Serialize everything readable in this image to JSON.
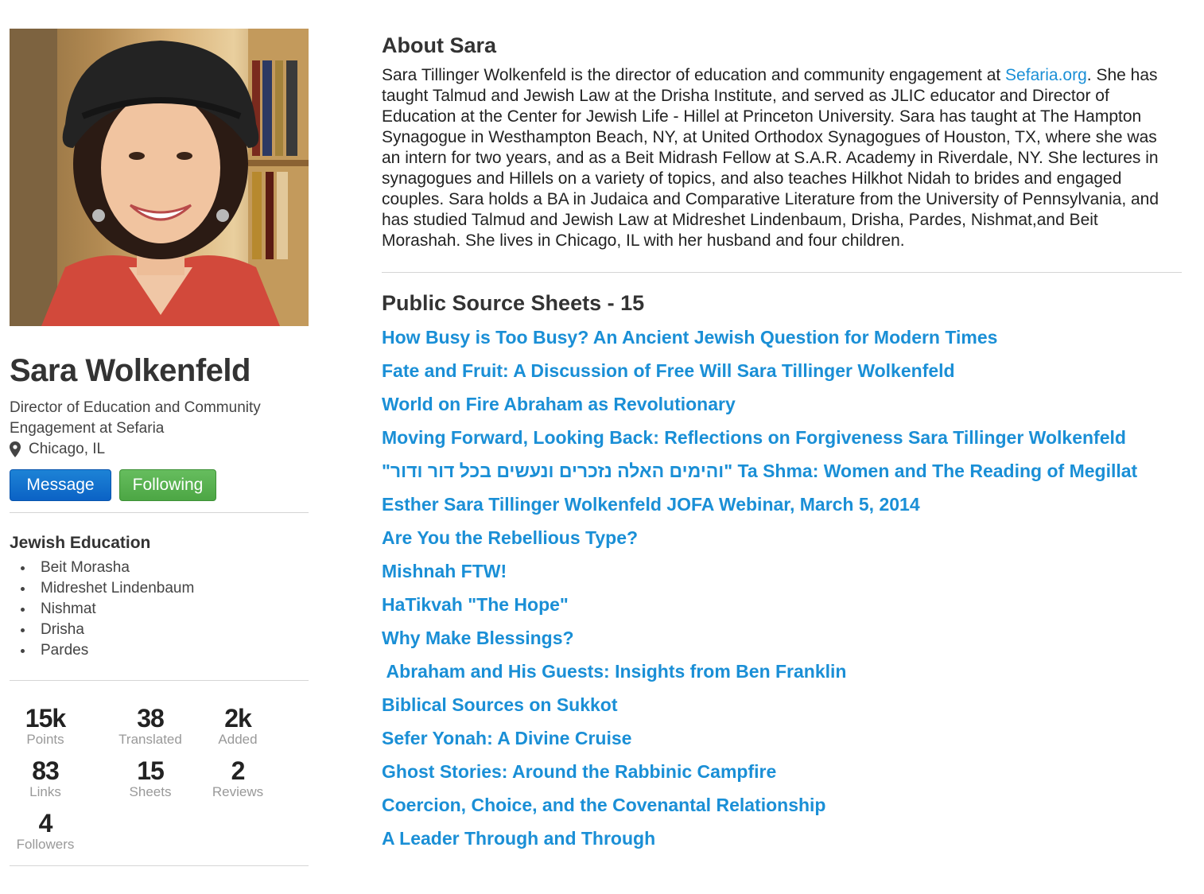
{
  "profile": {
    "name": "Sara Wolkenfeld",
    "title": "Director of Education and Community Engagement at Sefaria",
    "location": "Chicago, IL",
    "photo_alt": "Profile photo"
  },
  "buttons": {
    "message_label": "Message",
    "following_label": "Following"
  },
  "education": {
    "heading": "Jewish Education",
    "items": [
      "Beit Morasha",
      "Midreshet Lindenbaum",
      "Nishmat",
      "Drisha",
      "Pardes"
    ]
  },
  "stats": [
    {
      "value": "15k",
      "label": "Points"
    },
    {
      "value": "38",
      "label": "Translated"
    },
    {
      "value": "2k",
      "label": "Added"
    },
    {
      "value": "83",
      "label": "Links"
    },
    {
      "value": "15",
      "label": "Sheets"
    },
    {
      "value": "2",
      "label": "Reviews"
    },
    {
      "value": "4",
      "label": "Followers"
    }
  ],
  "about": {
    "heading": "About Sara",
    "bio_before_link": "Sara Tillinger Wolkenfeld is the director of education and community engagement at ",
    "bio_link": "Sefaria.org",
    "bio_after_link": ". She has taught Talmud and Jewish Law at the Drisha Institute, and served as JLIC educator and Director of Education at the Center for Jewish Life - Hillel at Princeton University. Sara has taught at The Hampton Synagogue in Westhampton Beach, NY, at United Orthodox Synagogues of Houston, TX, where she was an intern for two years, and as a Beit Midrash Fellow at S.A.R. Academy in Riverdale, NY. She lectures in synagogues and Hillels on a variety of topics, and also teaches Hilkhot Nidah to brides and engaged couples. Sara holds a BA in Judaica and Comparative Literature from the University of Pennsylvania, and has studied Talmud and Jewish Law at Midreshet Lindenbaum, Drisha, Pardes, Nishmat,and Beit Morashah. She lives in Chicago, IL with her husband and four children."
  },
  "sheets": {
    "heading": "Public Source Sheets - 15",
    "items": [
      "How Busy is Too Busy? An Ancient Jewish Question for Modern Times",
      "Fate and Fruit: A Discussion of Free Will Sara Tillinger Wolkenfeld",
      "World on Fire Abraham as Revolutionary",
      "Moving Forward, Looking Back: Reflections on Forgiveness Sara Tillinger Wolkenfeld",
      "\"והימים האלה נזכרים ונעשים בכל דור ודור\" Ta Shma: Women and The Reading of Megillat",
      "Esther Sara Tillinger Wolkenfeld JOFA Webinar, March 5, 2014",
      "Are You the Rebellious Type?",
      "Mishnah FTW!",
      "HaTikvah \"The Hope\"",
      "Why Make Blessings?",
      " Abraham and His Guests: Insights from Ben Franklin",
      "Biblical Sources on Sukkot",
      "Sefer Yonah: A Divine Cruise",
      "Ghost Stories: Around the Rabbinic Campfire",
      "Coercion, Choice, and the Covenantal Relationship",
      "A Leader Through and Through"
    ]
  },
  "colors": {
    "link": "#1a8fd6",
    "message_button": "#0b62c5",
    "following_button": "#4ca644",
    "divider": "#d5d5d5",
    "stat_label": "#999999"
  }
}
